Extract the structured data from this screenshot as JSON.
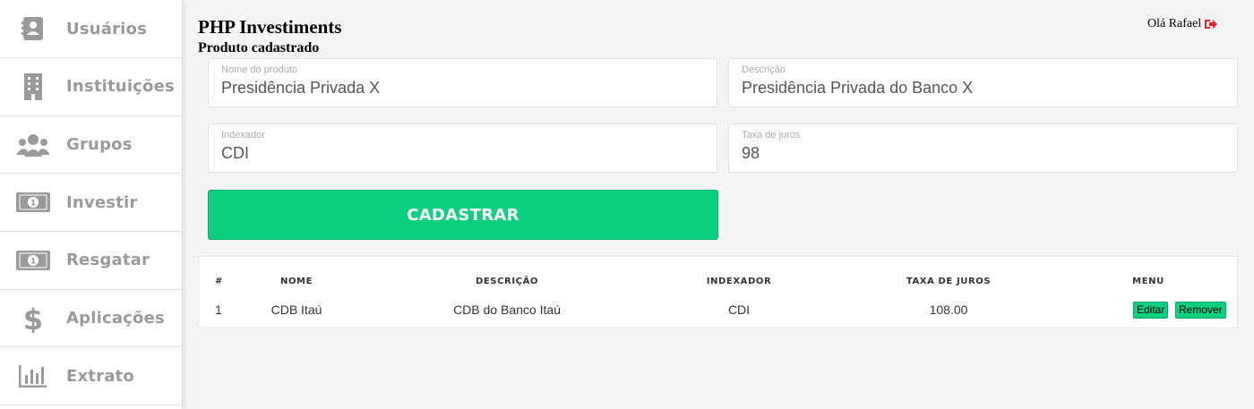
{
  "sidebar": {
    "items": [
      {
        "label": "Usuários",
        "icon": "address-book-icon"
      },
      {
        "label": "Instituições",
        "icon": "building-icon"
      },
      {
        "label": "Grupos",
        "icon": "users-icon"
      },
      {
        "label": "Investir",
        "icon": "money-bill-icon"
      },
      {
        "label": "Resgatar",
        "icon": "money-bill-icon"
      },
      {
        "label": "Aplicações",
        "icon": "dollar-sign-icon"
      },
      {
        "label": "Extrato",
        "icon": "bar-chart-icon"
      }
    ]
  },
  "header": {
    "title": "PHP Investiments",
    "subtitle": "Produto cadastrado",
    "greeting": "Olá Rafael"
  },
  "form": {
    "nome": {
      "label": "Nome do produto",
      "value": "Presidência Privada X"
    },
    "descricao": {
      "label": "Descrição",
      "value": "Presidência Privada do Banco X"
    },
    "indexador": {
      "label": "Indexador",
      "value": "CDI"
    },
    "taxa": {
      "label": "Taxa de juros",
      "value": "98"
    },
    "submit_label": "CADASTRAR"
  },
  "table": {
    "headers": [
      "#",
      "NOME",
      "DESCRIÇÃO",
      "INDEXADOR",
      "TAXA DE JUROS",
      "MENU"
    ],
    "rows": [
      {
        "id": "1",
        "nome": "CDB Itaú",
        "descricao": "CDB do Banco Itaú",
        "indexador": "CDI",
        "taxa": "108.00",
        "edit_label": "Editar",
        "remove_label": "Remover"
      }
    ]
  },
  "colors": {
    "accent": "#0ccf7f",
    "sidebar_text": "#9a9a9a",
    "logout_icon": "#e8202a"
  }
}
